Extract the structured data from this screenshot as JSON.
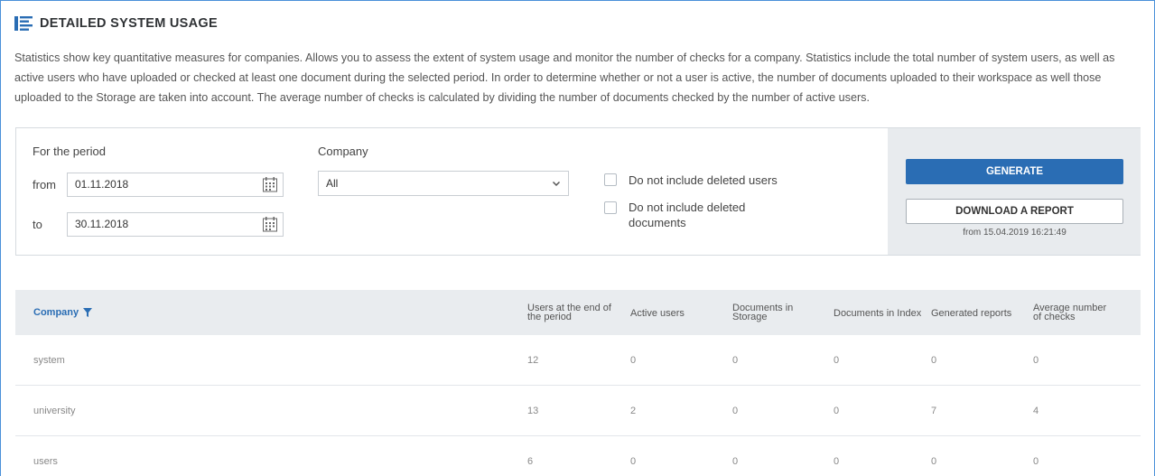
{
  "header": {
    "title": "DETAILED SYSTEM USAGE",
    "icon": "list-icon",
    "accent": "#2a6db4"
  },
  "description": "Statistics show key quantitative measures for companies. Allows you to assess the extent of system usage and monitor the number of checks for a company. Statistics include the total number of system users, as well as active users who have uploaded or checked at least one document during the selected period. In order to determine whether or not a user is active, the number of documents uploaded to their workspace as well those uploaded to the Storage are taken into account. The average number of checks is calculated by dividing the number of documents checked by the number of active users.",
  "filter": {
    "period_label": "For the period",
    "from_label": "from",
    "from_value": "01.11.2018",
    "to_label": "to",
    "to_value": "30.11.2018",
    "company_label": "Company",
    "company_value": "All",
    "cb_deleted_users": "Do not include deleted users",
    "cb_deleted_docs_line1": "Do not include deleted",
    "cb_deleted_docs_line2": "documents",
    "generate_label": "GENERATE",
    "download_label": "DOWNLOAD A REPORT",
    "download_note": "from 15.04.2019 16:21:49"
  },
  "table": {
    "columns": {
      "company": "Company",
      "users_end_l1": "Users at the end of",
      "users_end_l2": "the period",
      "active": "Active users",
      "storage_l1": "Documents in",
      "storage_l2": "Storage",
      "index": "Documents in Index",
      "reports": "Generated reports",
      "avg_l1": "Average number",
      "avg_l2": "of checks"
    },
    "rows": [
      {
        "company": "system",
        "users": "12",
        "active": "0",
        "storage": "0",
        "index": "0",
        "reports": "0",
        "avg": "0"
      },
      {
        "company": "university",
        "users": "13",
        "active": "2",
        "storage": "0",
        "index": "0",
        "reports": "7",
        "avg": "4"
      },
      {
        "company": "users",
        "users": "6",
        "active": "0",
        "storage": "0",
        "index": "0",
        "reports": "0",
        "avg": "0"
      }
    ]
  }
}
